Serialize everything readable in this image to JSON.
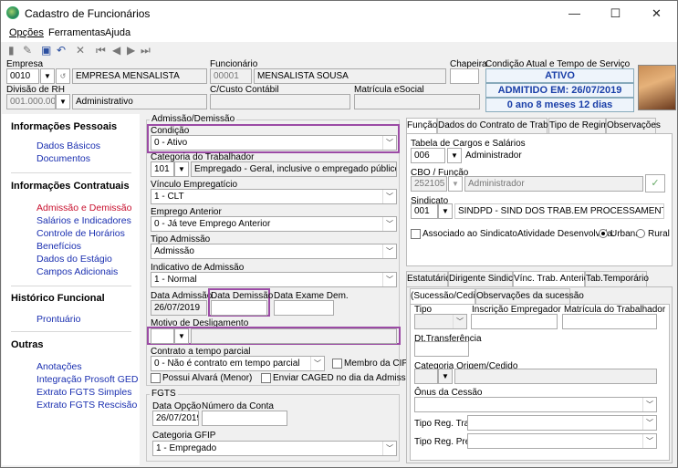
{
  "window": {
    "title": "Cadastro de Funcionários",
    "min": "—",
    "max": "☐",
    "close": "✕"
  },
  "menu": [
    "Opções",
    "Ferramentas",
    "Ajuda"
  ],
  "header": {
    "empresa_label": "Empresa",
    "empresa_code": "0010",
    "empresa_name": "EMPRESA MENSALISTA",
    "funcionario_label": "Funcionário",
    "funcionario_code": "00001",
    "funcionario_name": "MENSALISTA SOUSA",
    "chapeira_label": "Chapeira",
    "chapeira_value": "",
    "condicao_label": "Condição Atual e Tempo de Serviço",
    "status": "ATIVO",
    "admitido": "ADMITIDO EM: 26/07/2019",
    "tempo": "0 ano 8 meses 12 dias",
    "divisao_label": "Divisão de RH",
    "divisao_code": "001.000.000",
    "divisao_name": "Administrativo",
    "custo_label": "C/Custo Contábil",
    "custo_value": "",
    "matricula_label": "Matrícula eSocial",
    "matricula_value": ""
  },
  "sidebar": {
    "sections": [
      {
        "title": "Informações Pessoais",
        "items": [
          "Dados Básicos",
          "Documentos"
        ]
      },
      {
        "title": "Informações Contratuais",
        "items": [
          "Admissão e Demissão",
          "Salários e Indicadores",
          "Controle de Horários",
          "Benefícios",
          "Dados do Estágio",
          "Campos Adicionais"
        ]
      },
      {
        "title": "Histórico Funcional",
        "items": [
          "Prontuário"
        ]
      },
      {
        "title": "Outras",
        "items": [
          "Anotações",
          "Integração Prosoft GED",
          "Extrato FGTS Simples",
          "Extrato FGTS Rescisão"
        ]
      }
    ]
  },
  "admissao": {
    "group_title": "Admissão/Demissão",
    "condicao_label": "Condição",
    "condicao_value": "0 - Ativo",
    "categoria_label": "Categoria do Trabalhador",
    "categoria_code": "101",
    "categoria_desc": "Empregado - Geral, inclusive o empregado público da adminis",
    "vinculo_label": "Vínculo Empregatício",
    "vinculo_value": "1 - CLT",
    "emprego_ant_label": "Emprego Anterior",
    "emprego_ant_value": "0 - Já teve Emprego Anterior",
    "tipo_adm_label": "Tipo Admissão",
    "tipo_adm_value": "Admissão",
    "indicativo_label": "Indicativo de Admissão",
    "indicativo_value": "1 - Normal",
    "data_adm_label": "Data Admissão",
    "data_adm_value": "26/07/2019",
    "data_dem_label": "Data Demissão",
    "data_dem_value": "",
    "data_exame_label": "Data Exame Dem.",
    "data_exame_value": "",
    "motivo_label": "Motivo de Desligamento",
    "motivo_value": "",
    "contrato_label": "Contrato a tempo parcial",
    "contrato_value": "0 - Não é contrato em tempo parcial",
    "cipa_label": "Membro da CIPA",
    "alvara_label": "Possui Alvará (Menor)",
    "caged_label": "Enviar CAGED no dia da Admissão?"
  },
  "fgts": {
    "group_title": "FGTS",
    "data_opcao_label": "Data Opção",
    "data_opcao_value": "26/07/2019",
    "conta_label": "Número da Conta",
    "conta_value": "",
    "gfip_label": "Categoria GFIP",
    "gfip_value": "1 - Empregado"
  },
  "right_tabs": [
    "Função",
    "Dados do Contrato de Trabalho",
    "Tipo de Regime",
    "Observações"
  ],
  "funcao": {
    "tabela_label": "Tabela de Cargos e Salários",
    "tabela_code": "006",
    "tabela_desc": "Administrador",
    "cbo_label": "CBO / Função",
    "cbo_code": "252105",
    "cbo_desc": "Administrador",
    "sindicato_label": "Sindicato",
    "sindicato_code": "001",
    "sindicato_desc": "SINDPD - SIND DOS TRAB.EM PROCESSAMENTO DE DADOS ES",
    "associado_label": "Associado ao Sindicato",
    "atividade_label": "Atividade Desenvolvida:",
    "urbana_label": "Urbana",
    "rural_label": "Rural",
    "check_icon": "✓"
  },
  "lower_tabs": [
    "Estatutário",
    "Dirigente Sindical",
    "Vínc. Trab. Anterior",
    "Tab.Temporário"
  ],
  "sub_tabs": [
    "(Sucessão/Cedido)",
    "Observações da sucessão"
  ],
  "sucessao": {
    "tipo_label": "Tipo",
    "inscricao_label": "Inscrição Empregador",
    "matricula_label": "Matrícula do Trabalhador",
    "dt_transf_label": "Dt.Transferência",
    "categoria_label": "Categoria Origem/Cedido",
    "onus_label": "Ônus da Cessão",
    "reg_trab_label": "Tipo Reg. Trab.",
    "reg_prev_label": "Tipo Reg. Prev."
  }
}
